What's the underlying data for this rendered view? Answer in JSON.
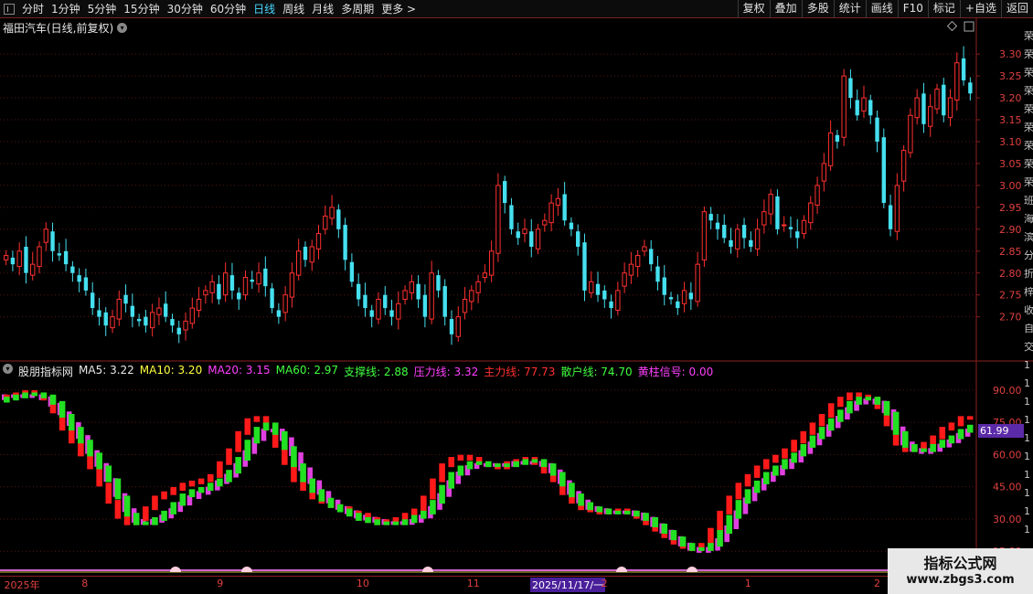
{
  "toolbar": {
    "periods": [
      "分时",
      "1分钟",
      "5分钟",
      "15分钟",
      "30分钟",
      "60分钟",
      "日线",
      "周线",
      "月线",
      "多周期",
      "更多 >"
    ],
    "active_period": "日线",
    "right_buttons": [
      "复权",
      "叠加",
      "多股",
      "统计",
      "画线",
      "F10",
      "标记",
      "+自选",
      "返回"
    ]
  },
  "stock": {
    "title": "福田汽车(日线,前复权)"
  },
  "colors": {
    "up": "#ff3030",
    "down": "#45e0f0",
    "indicator_red": "#ff1a1a",
    "indicator_green": "#22e022",
    "indicator_magenta": "#e040e0"
  },
  "price_axis": {
    "ticks": [
      "3.30",
      "3.25",
      "3.20",
      "3.15",
      "3.10",
      "3.05",
      "3.00",
      "2.95",
      "2.90",
      "2.85",
      "2.80",
      "2.75",
      "2.70"
    ]
  },
  "indicator": {
    "name": "股朋指标网",
    "legend": [
      {
        "text": "MA5: 3.22",
        "color": "#e8e8e8"
      },
      {
        "text": "MA10: 3.20",
        "color": "#ffff40"
      },
      {
        "text": "MA20: 3.15",
        "color": "#ff40ff"
      },
      {
        "text": "MA60: 2.97",
        "color": "#40ff40"
      },
      {
        "text": "支撑线: 2.88",
        "color": "#40ff40"
      },
      {
        "text": "压力线: 3.32",
        "color": "#ff40ff"
      },
      {
        "text": "主力线: 77.73",
        "color": "#ff3030"
      },
      {
        "text": "散户线: 74.70",
        "color": "#40ff40"
      },
      {
        "text": "黄柱信号: 0.00",
        "color": "#ff40ff"
      }
    ],
    "axis_ticks": [
      "90.00",
      "75.00",
      "60.00",
      "45.00",
      "30.00",
      "15.00"
    ],
    "current_value": "61.99"
  },
  "date_axis": {
    "labels": [
      {
        "text": "2025年",
        "pos": 0.004
      },
      {
        "text": "8",
        "pos": 0.079
      },
      {
        "text": "9",
        "pos": 0.21
      },
      {
        "text": "10",
        "pos": 0.345
      },
      {
        "text": "11",
        "pos": 0.452
      },
      {
        "text": "2",
        "pos": 0.582
      },
      {
        "text": "1",
        "pos": 0.721
      },
      {
        "text": "2",
        "pos": 0.846
      }
    ],
    "cursor_label": "2025/11/17/一"
  },
  "right_strip_chars": "荣荣荣荣荣荣荣荣荣班海滨分折梓收自交1111111111",
  "chart_data": {
    "type": "candlestick",
    "title": "福田汽车(日线,前复权)",
    "ylim": [
      2.62,
      3.34
    ],
    "price_series": [
      2.84,
      2.82,
      2.85,
      2.8,
      2.82,
      2.86,
      2.9,
      2.85,
      2.84,
      2.82,
      2.8,
      2.78,
      2.76,
      2.72,
      2.7,
      2.68,
      2.7,
      2.74,
      2.73,
      2.7,
      2.69,
      2.68,
      2.71,
      2.72,
      2.7,
      2.68,
      2.66,
      2.69,
      2.72,
      2.74,
      2.76,
      2.78,
      2.74,
      2.8,
      2.76,
      2.74,
      2.79,
      2.78,
      2.8,
      2.77,
      2.72,
      2.7,
      2.75,
      2.8,
      2.85,
      2.83,
      2.86,
      2.89,
      2.93,
      2.95,
      2.9,
      2.83,
      2.78,
      2.74,
      2.72,
      2.7,
      2.74,
      2.72,
      2.7,
      2.73,
      2.76,
      2.78,
      2.74,
      2.7,
      2.8,
      2.76,
      2.7,
      2.66,
      2.7,
      2.74,
      2.76,
      2.78,
      2.8,
      2.85,
      3.0,
      2.96,
      2.9,
      2.88,
      2.9,
      2.86,
      2.9,
      2.92,
      2.96,
      2.97,
      2.92,
      2.9,
      2.86,
      2.76,
      2.78,
      2.75,
      2.74,
      2.72,
      2.76,
      2.8,
      2.82,
      2.84,
      2.86,
      2.82,
      2.78,
      2.75,
      2.74,
      2.72,
      2.76,
      2.74,
      2.82,
      2.94,
      2.92,
      2.9,
      2.88,
      2.86,
      2.9,
      2.88,
      2.86,
      2.9,
      2.94,
      2.98,
      2.9,
      2.91,
      2.9,
      2.88,
      2.92,
      2.96,
      3.0,
      3.05,
      3.12,
      3.1,
      3.25,
      3.2,
      3.16,
      3.2,
      3.16,
      3.1,
      2.96,
      2.9,
      3.0,
      3.08,
      3.16,
      3.2,
      3.14,
      3.18,
      3.22,
      3.16,
      3.2,
      3.28,
      3.24,
      3.21
    ],
    "indicator_series": [
      {
        "name": "主力线",
        "color": "#ff1a1a",
        "values": [
          86,
          87,
          88,
          89,
          88,
          86,
          80,
          72,
          66,
          60,
          54,
          46,
          38,
          31,
          28,
          30,
          35,
          40,
          42,
          44,
          46,
          47,
          48,
          50,
          56,
          62,
          70,
          76,
          77,
          72,
          64,
          56,
          48,
          44,
          40,
          38,
          36,
          35,
          33,
          32,
          30,
          28,
          29,
          30,
          32,
          34,
          40,
          48,
          55,
          58,
          59,
          58,
          56,
          55,
          54,
          56,
          57,
          58,
          56,
          52,
          48,
          42,
          38,
          35,
          34,
          33,
          34,
          34,
          33,
          31,
          28,
          25,
          22,
          19,
          17,
          16,
          18,
          25,
          33,
          40,
          46,
          50,
          54,
          57,
          59,
          62,
          66,
          70,
          74,
          78,
          83,
          86,
          88,
          87,
          86,
          82,
          74,
          65,
          62,
          63,
          65,
          68,
          72,
          74,
          77,
          77
        ]
      },
      {
        "name": "散户线",
        "color": "#22e022",
        "values": [
          85,
          86,
          87,
          88,
          88,
          87,
          84,
          78,
          72,
          66,
          60,
          54,
          48,
          40,
          32,
          28,
          28,
          30,
          33,
          37,
          41,
          43,
          44,
          46,
          48,
          52,
          58,
          66,
          72,
          74,
          70,
          63,
          55,
          48,
          43,
          39,
          36,
          34,
          32,
          30,
          29,
          28,
          28,
          28,
          29,
          31,
          33,
          38,
          45,
          51,
          54,
          56,
          56,
          55,
          55,
          55,
          56,
          57,
          57,
          55,
          51,
          46,
          41,
          37,
          35,
          34,
          33,
          33,
          33,
          32,
          30,
          27,
          24,
          21,
          18,
          16,
          16,
          18,
          24,
          31,
          38,
          43,
          47,
          51,
          54,
          57,
          60,
          64,
          68,
          72,
          76,
          80,
          84,
          86,
          86,
          84,
          79,
          70,
          64,
          62,
          62,
          64,
          66,
          68,
          71,
          73
        ]
      },
      {
        "name": "压力线",
        "color": "#e040e0",
        "values": [
          87,
          88,
          88,
          88,
          88,
          87,
          84,
          80,
          75,
          69,
          62,
          56,
          49,
          42,
          35,
          30,
          29,
          30,
          32,
          35,
          38,
          41,
          43,
          45,
          48,
          51,
          56,
          62,
          68,
          72,
          72,
          68,
          61,
          54,
          48,
          43,
          39,
          36,
          34,
          32,
          31,
          30,
          29,
          29,
          29,
          30,
          32,
          36,
          42,
          48,
          52,
          55,
          56,
          56,
          56,
          56,
          57,
          57,
          57,
          56,
          53,
          48,
          43,
          39,
          36,
          35,
          34,
          34,
          34,
          33,
          31,
          28,
          25,
          22,
          19,
          17,
          16,
          17,
          21,
          27,
          34,
          40,
          45,
          49,
          52,
          55,
          58,
          62,
          66,
          70,
          74,
          78,
          82,
          85,
          86,
          85,
          81,
          73,
          66,
          63,
          62,
          63,
          65,
          67,
          70,
          72
        ]
      }
    ],
    "indicator_ylim": [
      10,
      95
    ]
  }
}
